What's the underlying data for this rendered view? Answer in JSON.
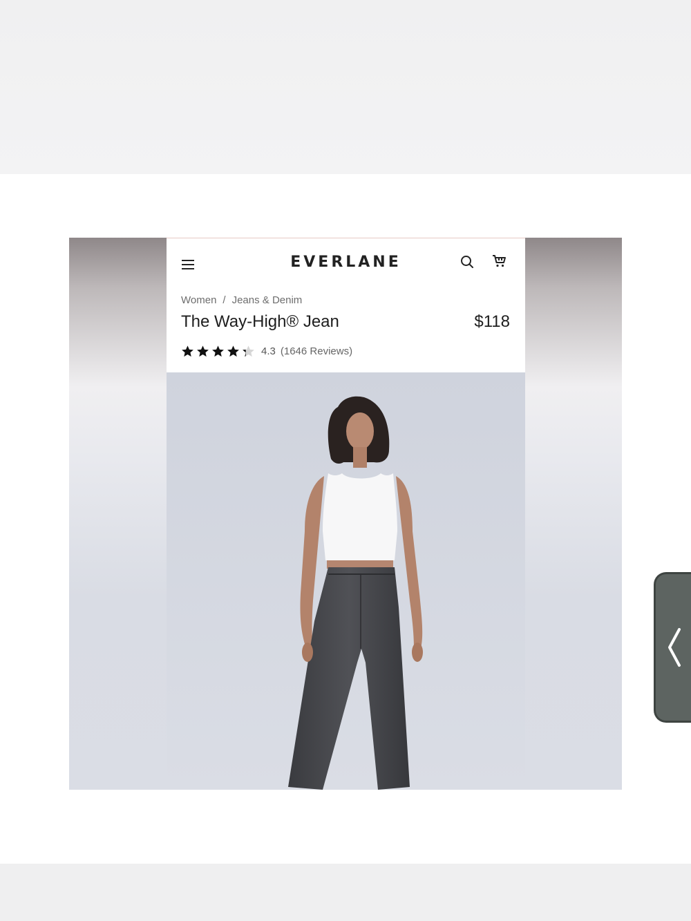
{
  "header": {
    "brand": "EVERLANE",
    "icons": [
      "menu-icon",
      "search-icon",
      "cart-icon"
    ]
  },
  "breadcrumb": {
    "items": [
      "Women",
      "Jeans & Denim"
    ],
    "separator": "/"
  },
  "product": {
    "title": "The Way-High® Jean",
    "price": "$118",
    "rating_value": "4.3",
    "reviews_text": "(1646 Reviews)",
    "stars_filled": 4.3,
    "stars_max": 5
  },
  "photo": {
    "subject": "model-in-white-tank-and-black-jeans"
  },
  "colors": {
    "text": "#1e1e1e",
    "muted": "#6d6d6d",
    "denim": "#3f4044",
    "side_tab": "#5d6461"
  },
  "side_tab": {
    "icon": "chevron-left-icon"
  }
}
